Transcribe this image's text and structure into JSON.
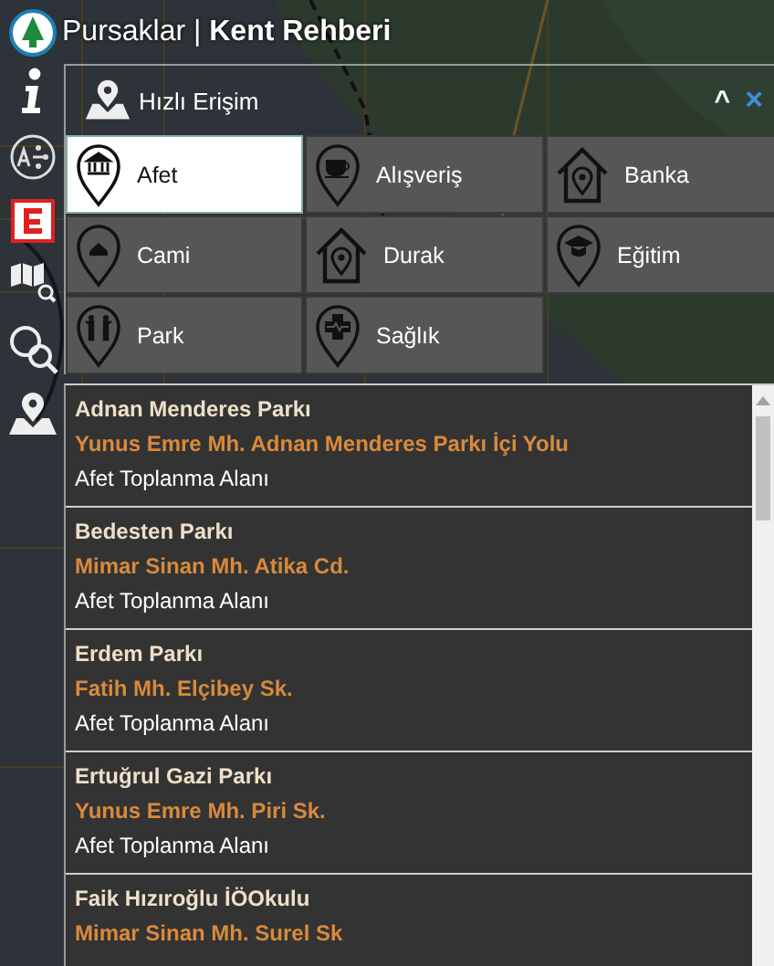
{
  "app_title": "Pursaklar | **Kent Rehberi**",
  "panel": {
    "title": "Hızlı Erişim",
    "collapse": "^",
    "close": "×"
  },
  "categories": [
    {
      "label": "Afet",
      "selected": true
    },
    {
      "label": "Alışveriş",
      "selected": false
    },
    {
      "label": "Banka",
      "selected": false
    },
    {
      "label": "Cami",
      "selected": false
    },
    {
      "label": "Durak",
      "selected": false
    },
    {
      "label": "Eğitim",
      "selected": false
    },
    {
      "label": "Park",
      "selected": false
    },
    {
      "label": "Sağlık",
      "selected": false
    }
  ],
  "results": [
    {
      "name": "Adnan Menderes Parkı",
      "address": "Yunus Emre Mh. Adnan Menderes Parkı İçi Yolu",
      "category": "Afet Toplanma Alanı"
    },
    {
      "name": "Bedesten Parkı",
      "address": "Mimar Sinan Mh. Atika Cd.",
      "category": "Afet Toplanma Alanı"
    },
    {
      "name": "Erdem Parkı",
      "address": "Fatih Mh. Elçibey Sk.",
      "category": "Afet Toplanma Alanı"
    },
    {
      "name": "Ertuğrul Gazi Parkı",
      "address": "Yunus Emre Mh. Piri Sk.",
      "category": "Afet Toplanma Alanı"
    },
    {
      "name": "Faik Hızıroğlu İÖOkulu",
      "address": "Mimar Sinan Mh. Surel Sk"
    }
  ]
}
